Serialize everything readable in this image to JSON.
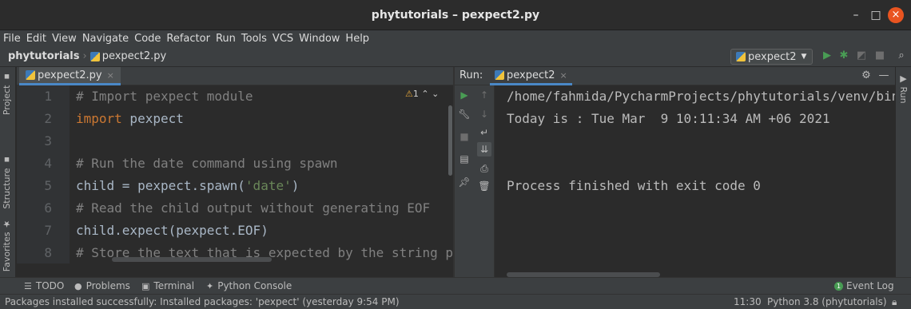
{
  "window": {
    "title": "phytutorials – pexpect2.py",
    "minimize": "–",
    "maximize": "□",
    "close": "×"
  },
  "menu": [
    "File",
    "Edit",
    "View",
    "Navigate",
    "Code",
    "Refactor",
    "Run",
    "Tools",
    "VCS",
    "Window",
    "Help"
  ],
  "navbar": {
    "project": "phytutorials",
    "file": "pexpect2.py",
    "run_config": "pexpect2"
  },
  "left_tabs": [
    "Project",
    "Structure",
    "Favorites"
  ],
  "right_tabs": [
    "Run"
  ],
  "editor": {
    "tab_label": "pexpect2.py",
    "warning_count": "1",
    "line_numbers": [
      "1",
      "2",
      "3",
      "4",
      "5",
      "6",
      "7",
      "8"
    ],
    "lines": [
      [
        {
          "t": "# Import pexpect module",
          "c": "cm"
        }
      ],
      [
        {
          "t": "import",
          "c": "kw"
        },
        {
          "t": " pexpect",
          "c": ""
        }
      ],
      [
        {
          "t": "",
          "c": ""
        }
      ],
      [
        {
          "t": "# Run the date command using spawn",
          "c": "cm"
        }
      ],
      [
        {
          "t": "child = pexpect.spawn(",
          "c": ""
        },
        {
          "t": "'date'",
          "c": "st"
        },
        {
          "t": ")",
          "c": ""
        }
      ],
      [
        {
          "t": "# Read the child output without generating EOF",
          "c": "cm"
        }
      ],
      [
        {
          "t": "child.expect(pexpect.EOF)",
          "c": ""
        }
      ],
      [
        {
          "t": "# Store the text that is expected by the string pattern",
          "c": "cm"
        }
      ]
    ]
  },
  "run": {
    "label": "Run:",
    "tab_label": "pexpect2",
    "output": [
      "/home/fahmida/PycharmProjects/phytutorials/venv/bin/python",
      "Today is : Tue Mar  9 10:11:34 AM +06 2021",
      "",
      "",
      "Process finished with exit code 0"
    ]
  },
  "bottom_tools": {
    "todo": "TODO",
    "problems": "Problems",
    "terminal": "Terminal",
    "python_console": "Python Console",
    "event_log": "Event Log"
  },
  "status": {
    "message": "Packages installed successfully: Installed packages: 'pexpect' (yesterday 9:54 PM)",
    "position": "11:30",
    "interpreter": "Python 3.8 (phytutorials)"
  }
}
